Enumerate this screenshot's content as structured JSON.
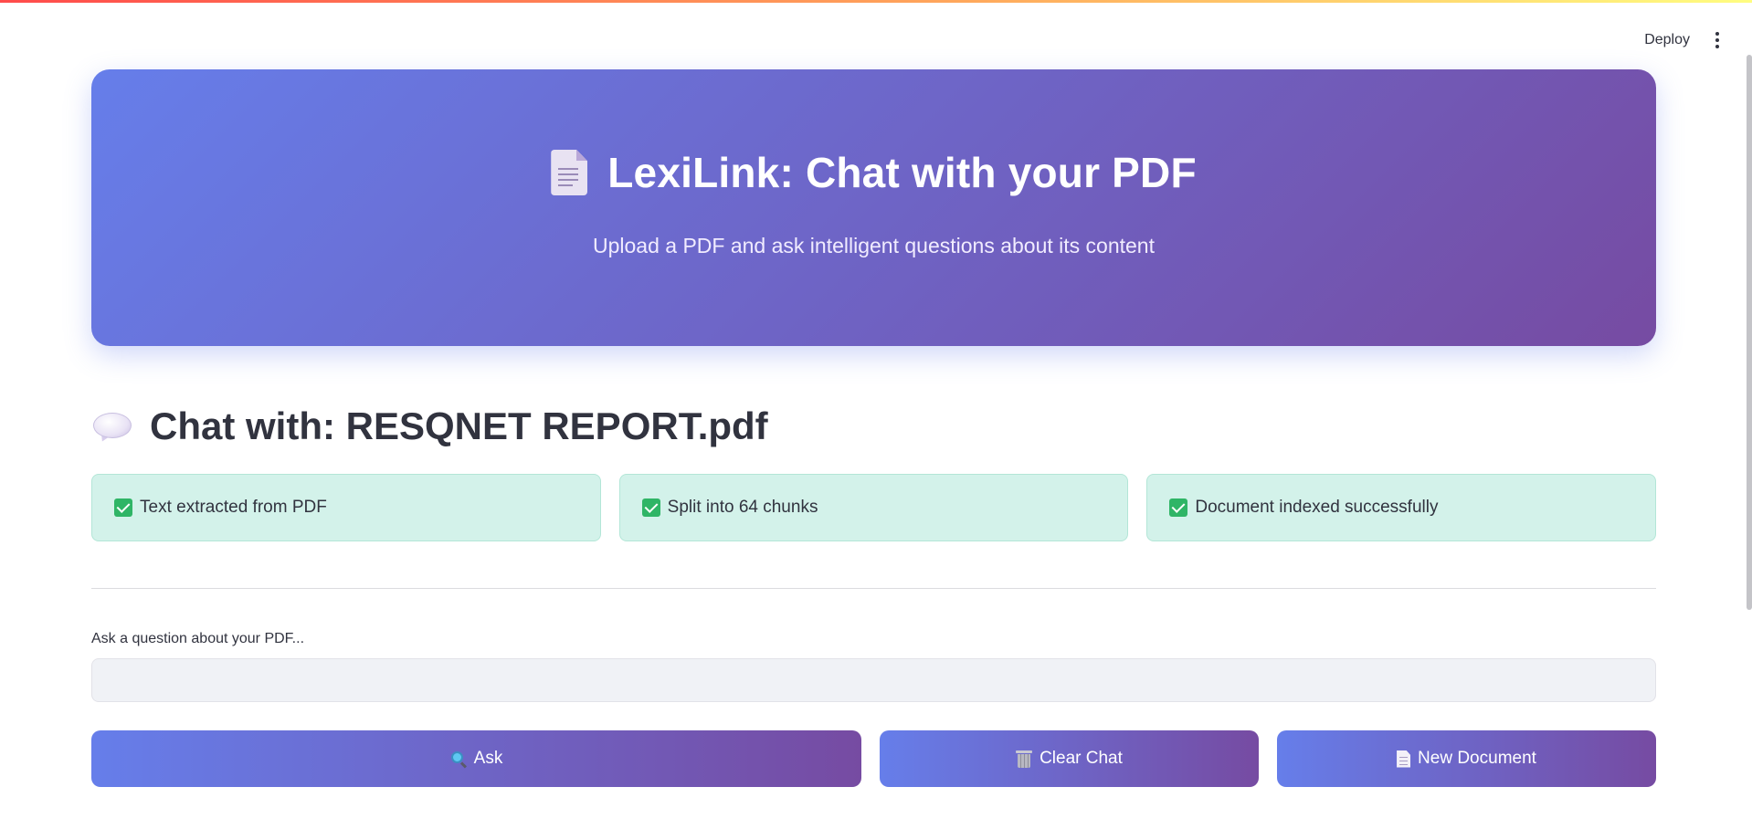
{
  "header": {
    "deploy_label": "Deploy",
    "menu_icon": "kebab-menu-icon"
  },
  "hero": {
    "icon": "document-icon",
    "title": "LexiLink: Chat with your PDF",
    "subtitle": "Upload a PDF and ask intelligent questions about its content"
  },
  "chat": {
    "icon": "speech-balloon-icon",
    "heading": "Chat with: RESQNET REPORT.pdf"
  },
  "status": [
    {
      "icon": "check-icon",
      "text": "Text extracted from PDF"
    },
    {
      "icon": "check-icon",
      "text": "Split into 64 chunks"
    },
    {
      "icon": "check-icon",
      "text": "Document indexed successfully"
    }
  ],
  "question": {
    "label": "Ask a question about your PDF...",
    "value": "",
    "placeholder": ""
  },
  "buttons": {
    "ask": {
      "icon": "magnifier-icon",
      "label": "Ask"
    },
    "clear": {
      "icon": "trash-icon",
      "label": "Clear Chat"
    },
    "new_doc": {
      "icon": "page-icon",
      "label": "New Document"
    }
  },
  "colors": {
    "gradient_start": "#667eea",
    "gradient_end": "#764ba2",
    "success_bg": "#d3f2ea",
    "text": "#31333f"
  }
}
